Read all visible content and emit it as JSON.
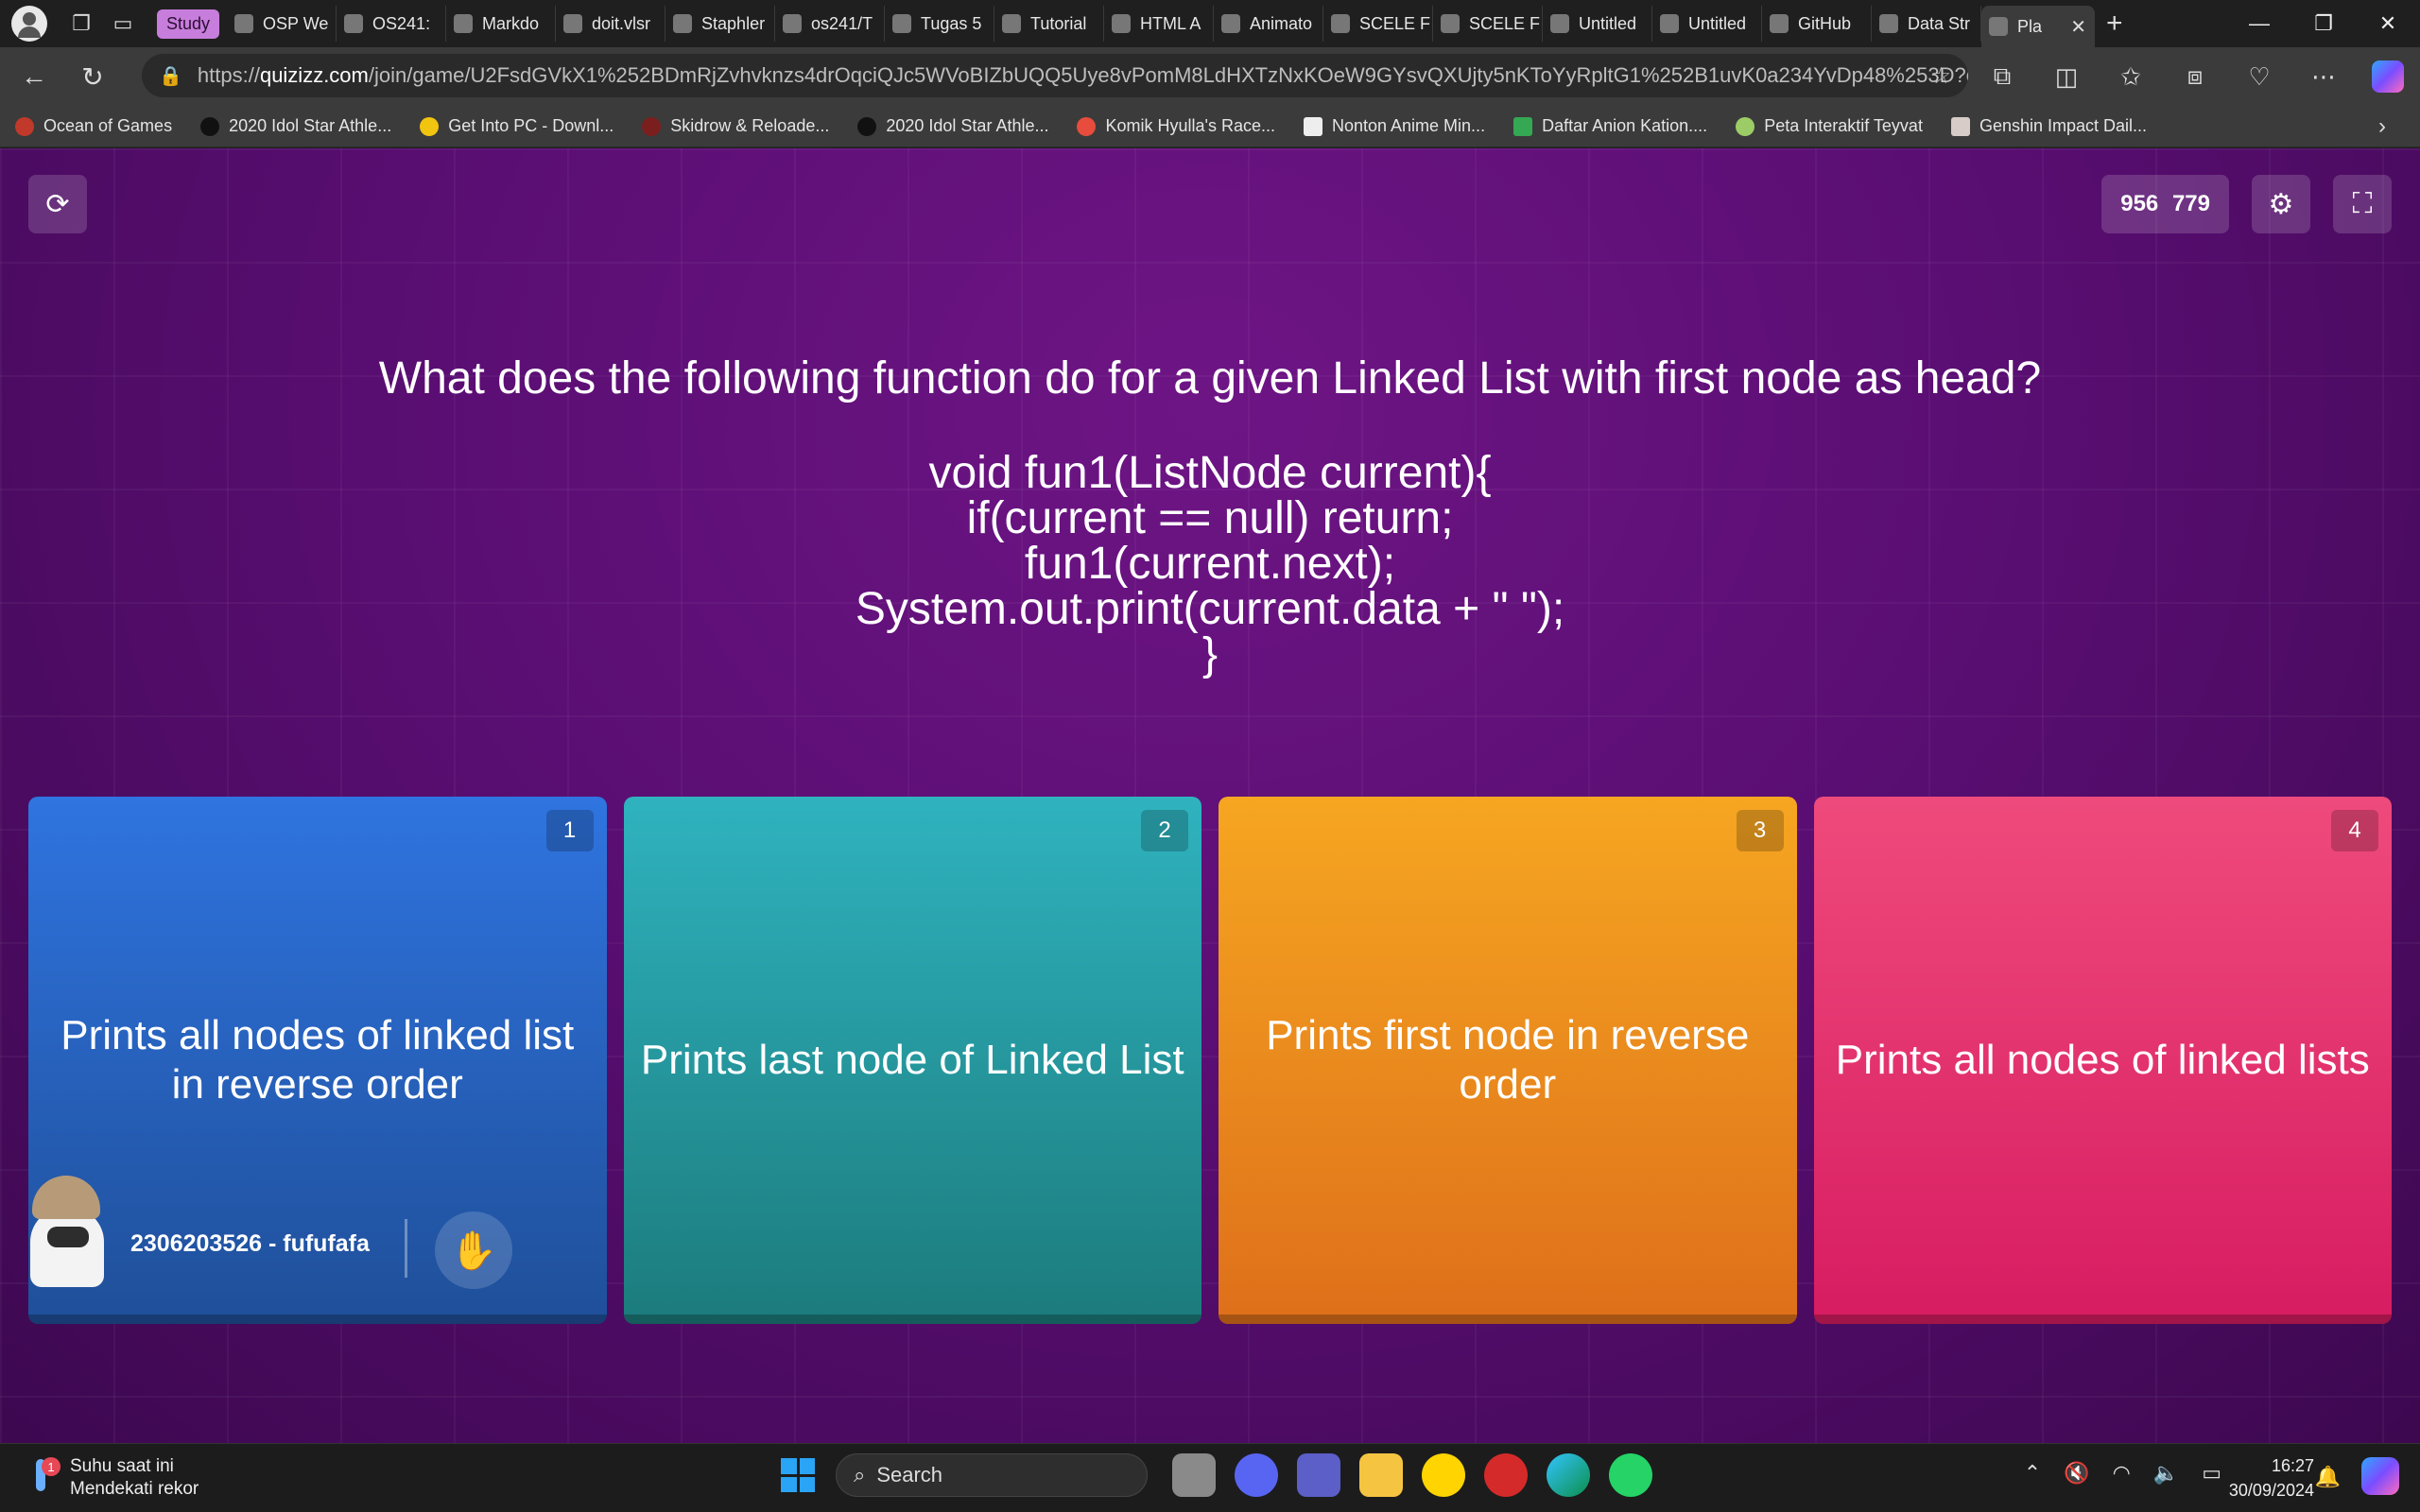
{
  "browser": {
    "tab_group_label": "Study",
    "tabs": [
      {
        "title": "OSP We"
      },
      {
        "title": "OS241:"
      },
      {
        "title": "Markdo"
      },
      {
        "title": "doit.vlsr"
      },
      {
        "title": "Staphler"
      },
      {
        "title": "os241/T"
      },
      {
        "title": "Tugas 5"
      },
      {
        "title": "Tutorial"
      },
      {
        "title": "HTML A"
      },
      {
        "title": "Animato"
      },
      {
        "title": "SCELE F"
      },
      {
        "title": "SCELE F"
      },
      {
        "title": "Untitled"
      },
      {
        "title": "Untitled"
      },
      {
        "title": "GitHub"
      },
      {
        "title": "Data Str"
      },
      {
        "title": "Pla",
        "active": true
      }
    ],
    "url_prefix": "https://",
    "url_host": "quizizz.com",
    "url_path": "/join/game/U2FsdGVkX1%252BDmRjZvhvknzs4drOqciQJc5WVoBIZbUQQ5Uye8vPomM8LdHXTzNxKOeW9GYsvQXUjty5nKToYyRpltG1%252B1uvK0a234YvDp48%253D?gam...",
    "bookmarks": [
      "Ocean of Games",
      "2020 Idol Star Athle...",
      "Get Into PC - Downl...",
      "Skidrow & Reloade...",
      "2020 Idol Star Athle...",
      "Komik Hyulla's Race...",
      "Nonton Anime Min...",
      "Daftar Anion Kation....",
      "Peta Interaktif Teyvat",
      "Genshin Impact Dail..."
    ]
  },
  "quiz": {
    "score_left": "956",
    "score_right": "779",
    "question": "What does the following function do for a given Linked List with first node as head?",
    "code_lines": [
      "void fun1(ListNode current){",
      "if(current == null) return;",
      "fun1(current.next);",
      "System.out.print(current.data + \" \");",
      "}"
    ],
    "options": [
      {
        "number": "1",
        "text": "Prints all nodes of linked list in reverse order",
        "color": "#2f74e0"
      },
      {
        "number": "2",
        "text": "Prints last node of Linked List",
        "color": "#2fb3bf"
      },
      {
        "number": "3",
        "text": "Prints first node in reverse order",
        "color": "#f6a621"
      },
      {
        "number": "4",
        "text": "Prints all nodes of linked lists",
        "color": "#ef4a7c"
      }
    ],
    "player_name": "2306203526 - fufufafa"
  },
  "taskbar": {
    "weather_title": "Suhu saat ini",
    "weather_sub": "Mendekati rekor",
    "weather_badge": "1",
    "search_placeholder": "Search",
    "time": "16:27",
    "date": "30/09/2024"
  },
  "icons": {
    "refresh": "refresh-icon",
    "settings": "gear-icon",
    "fullscreen": "fullscreen-icon",
    "raise_hand": "hand-icon"
  }
}
